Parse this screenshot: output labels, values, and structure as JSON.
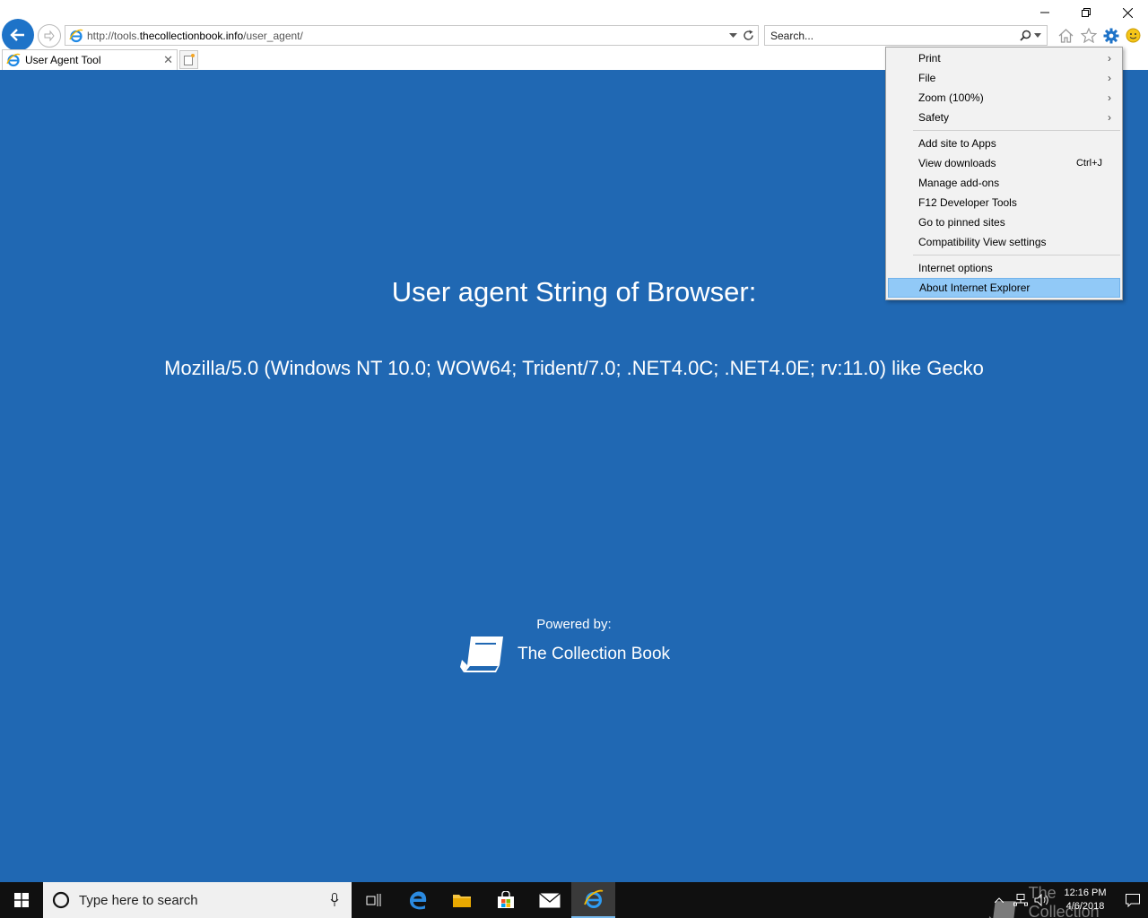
{
  "browser": {
    "url_prefix": "http://tools.",
    "url_domain": "thecollectionbook.info",
    "url_path": "/user_agent/",
    "search_placeholder": "Search...",
    "tab_title": "User Agent Tool"
  },
  "page": {
    "heading": "User agent String of Browser:",
    "user_agent": "Mozilla/5.0 (Windows NT 10.0; WOW64; Trident/7.0; .NET4.0C; .NET4.0E; rv:11.0) like Gecko",
    "powered_by_label": "Powered by:",
    "brand_name": "The Collection Book"
  },
  "tools_menu": {
    "groups": [
      [
        {
          "label": "Print",
          "submenu": true
        },
        {
          "label": "File",
          "submenu": true
        },
        {
          "label": "Zoom (100%)",
          "submenu": true
        },
        {
          "label": "Safety",
          "submenu": true
        }
      ],
      [
        {
          "label": "Add site to Apps"
        },
        {
          "label": "View downloads",
          "shortcut": "Ctrl+J"
        },
        {
          "label": "Manage add-ons"
        },
        {
          "label": "F12 Developer Tools"
        },
        {
          "label": "Go to pinned sites"
        },
        {
          "label": "Compatibility View settings"
        }
      ],
      [
        {
          "label": "Internet options"
        },
        {
          "label": "About Internet Explorer",
          "highlighted": true
        }
      ]
    ]
  },
  "taskbar": {
    "search_placeholder": "Type here to search",
    "time": "12:16 PM",
    "date": "4/6/2018",
    "watermark": "The Collection Book"
  },
  "colors": {
    "page_background": "#2068b3",
    "accent": "#1e73c8",
    "menu_highlight": "#91c9f7",
    "taskbar": "#101010"
  }
}
